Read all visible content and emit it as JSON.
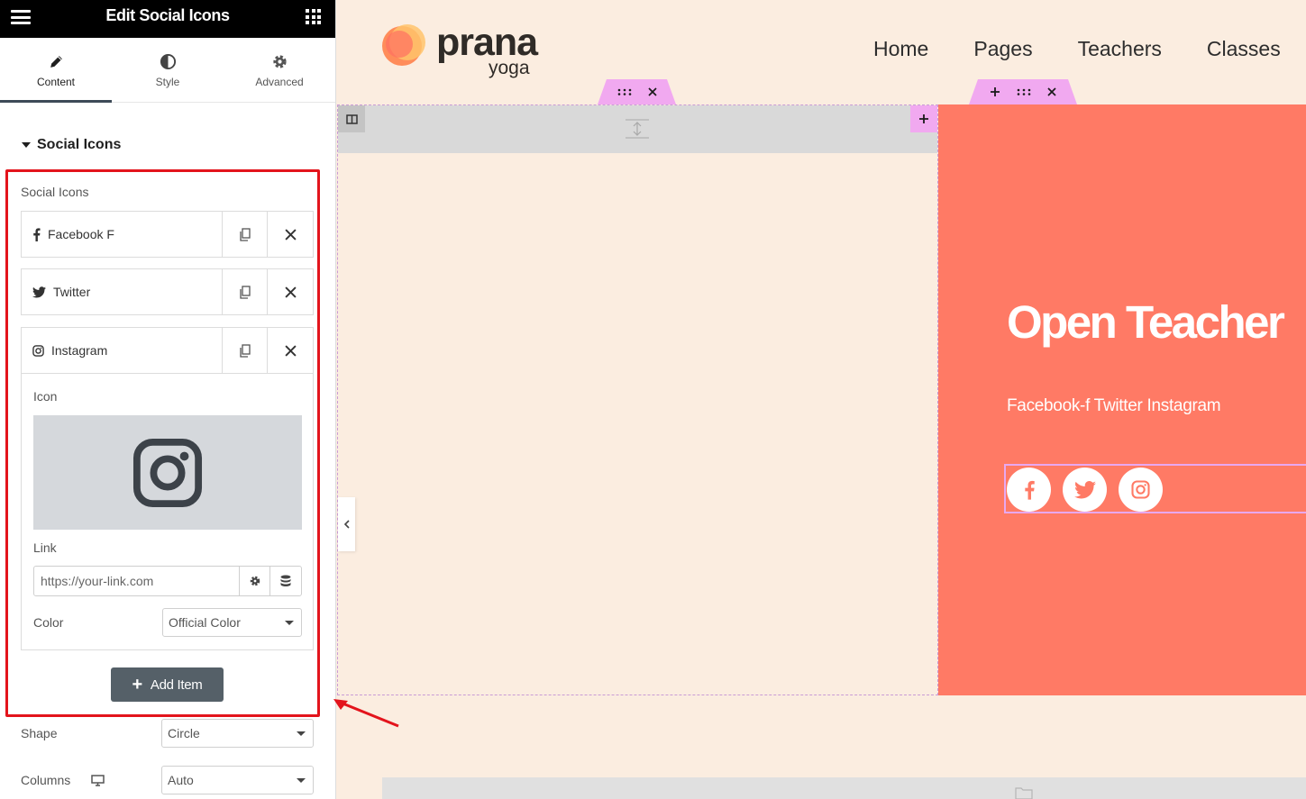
{
  "panel": {
    "title": "Edit Social Icons",
    "tabs": [
      {
        "label": "Content",
        "icon": "pencil-icon"
      },
      {
        "label": "Style",
        "icon": "half-circle-icon"
      },
      {
        "label": "Advanced",
        "icon": "gear-icon"
      }
    ],
    "section_title": "Social Icons",
    "list_label": "Social Icons",
    "items": [
      {
        "label": "Facebook F",
        "icon": "facebook-icon"
      },
      {
        "label": "Twitter",
        "icon": "twitter-icon"
      },
      {
        "label": "Instagram",
        "icon": "instagram-icon"
      }
    ],
    "icon_label": "Icon",
    "link_label": "Link",
    "link_placeholder": "https://your-link.com",
    "color_label": "Color",
    "color_value": "Official Color",
    "add_item_label": "Add Item",
    "shape_label": "Shape",
    "shape_value": "Circle",
    "columns_label": "Columns",
    "columns_value": "Auto",
    "highlight_color": "#e3141c"
  },
  "site": {
    "brand": "prana",
    "brand_sub": "yoga",
    "nav": [
      "Home",
      "Pages",
      "Teachers",
      "Classes"
    ],
    "hero_title": "Open Teacher",
    "hero_text": "Facebook-f Twitter Instagram",
    "hero_bg": "#ff7a65",
    "social": [
      "facebook-icon",
      "twitter-icon",
      "instagram-icon"
    ]
  }
}
